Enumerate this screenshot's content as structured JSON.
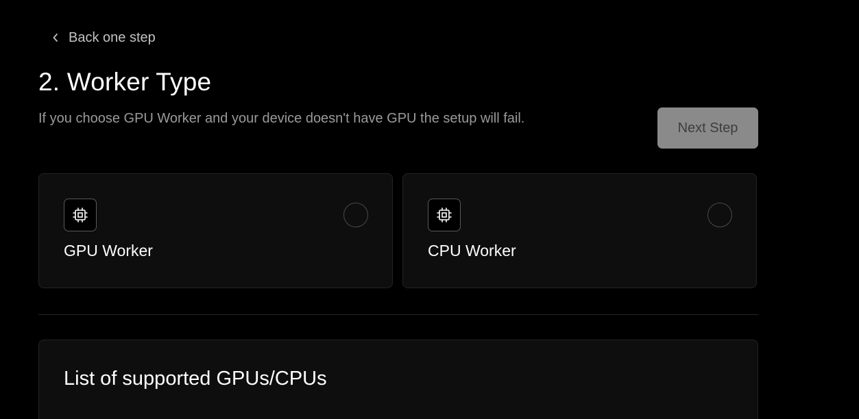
{
  "back": {
    "label": "Back one step",
    "icon": "chevron-left-icon"
  },
  "step": {
    "title": "2. Worker Type",
    "description": "If you choose GPU Worker and your device doesn't have GPU the setup will fail."
  },
  "next_button": {
    "label": "Next Step"
  },
  "options": [
    {
      "label": "GPU Worker",
      "icon": "chip-icon",
      "selected": false
    },
    {
      "label": "CPU Worker",
      "icon": "chip-icon",
      "selected": false
    }
  ],
  "supported_list": {
    "title": "List of supported GPUs/CPUs"
  },
  "colors": {
    "background": "#000000",
    "card": "#0e0e0e",
    "border": "#232323",
    "muted_text": "#9a9a9a",
    "button_disabled": "#8a8a8a"
  }
}
